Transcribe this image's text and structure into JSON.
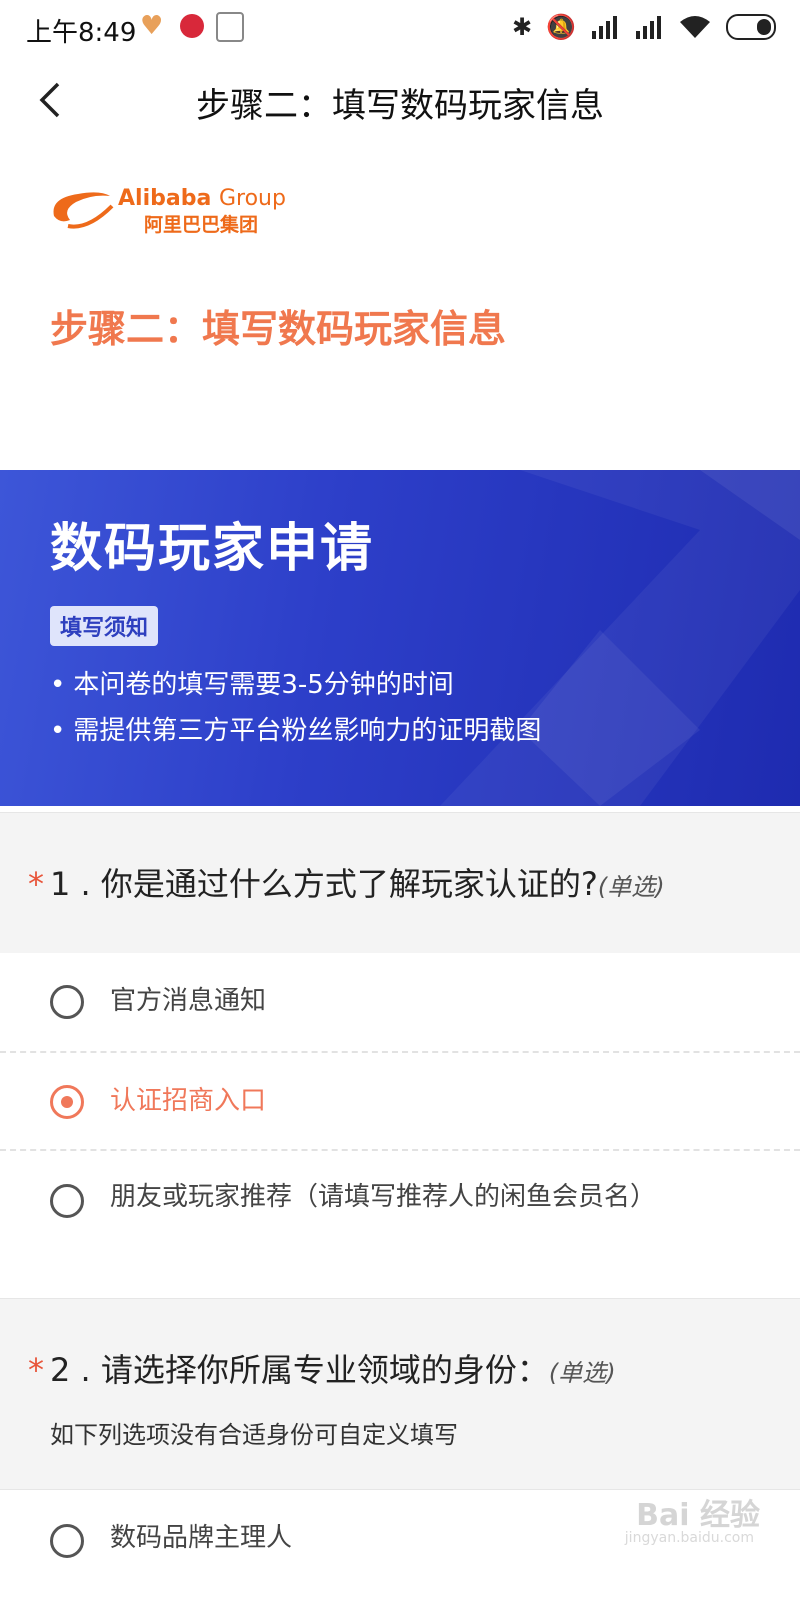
{
  "status_bar": {
    "time": "上午8:49",
    "left_icons": [
      "health-heart-icon",
      "bank-app-icon",
      "phone-app-icon"
    ],
    "right_icons": [
      "bluetooth-icon",
      "bell-muted-icon",
      "hd-signal-icon",
      "signal-icon",
      "wifi-icon",
      "battery-icon"
    ]
  },
  "header": {
    "title": "步骤二：填写数码玩家信息"
  },
  "logo": {
    "en": "Alibaba",
    "group": "Group",
    "cn": "阿里巴巴集团"
  },
  "step_title": "步骤二：填写数码玩家信息",
  "banner": {
    "title": "数码玩家申请",
    "tag": "填写须知",
    "notes": [
      "本问卷的填写需要3-5分钟的时间",
      "需提供第三方平台粉丝影响力的证明截图"
    ],
    "colors": {
      "start": "#3d56d8",
      "end": "#1e2bb0"
    }
  },
  "questions": [
    {
      "required_mark": "*",
      "title": "1 . 你是通过什么方式了解玩家认证的?",
      "type": "(单选)",
      "options": [
        {
          "label": "官方消息通知",
          "selected": false
        },
        {
          "label": "认证招商入口",
          "selected": true
        },
        {
          "label": "朋友或玩家推荐（请填写推荐人的闲鱼会员名）",
          "selected": false
        }
      ]
    },
    {
      "required_mark": "*",
      "title": "2 . 请选择你所属专业领域的身份：",
      "type": "(单选)",
      "hint": "如下列选项没有合适身份可自定义填写",
      "options": [
        {
          "label": "数码品牌主理人",
          "selected": false
        }
      ]
    }
  ],
  "watermark": {
    "text": "Bai 经验",
    "url": "jingyan.baidu.com"
  },
  "colors": {
    "accent": "#f0785a",
    "brand_orange": "#ee6a1a"
  }
}
